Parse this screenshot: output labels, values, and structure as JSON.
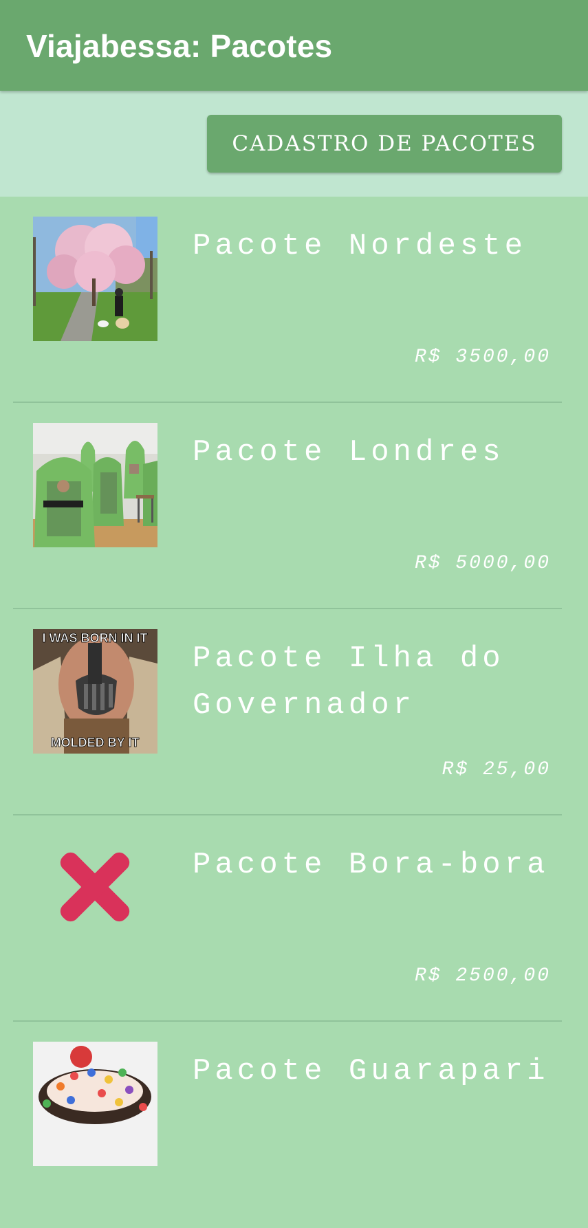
{
  "app": {
    "title": "Viajabessa: Pacotes"
  },
  "toolbar": {
    "button_label": "CADASTRO DE PACOTES"
  },
  "packages": [
    {
      "name": "Pacote Nordeste",
      "price": "R$ 3500,00",
      "image": "cherry-blossom-street-photo"
    },
    {
      "name": "Pacote Londres",
      "price": "R$ 5000,00",
      "image": "green-booths-room-photo"
    },
    {
      "name": "Pacote Ilha do Governador",
      "price": "R$ 25,00",
      "image": "bane-meme",
      "image_text": {
        "top": "I WAS BORN IN IT",
        "bottom": "MOLDED BY IT"
      }
    },
    {
      "name": "Pacote Bora-bora",
      "price": "R$ 2500,00",
      "image": "close-x-icon"
    },
    {
      "name": "Pacote Guarapari",
      "price": "",
      "image": "dessert-bowl-photo"
    }
  ],
  "colors": {
    "appbar": "#6aa86e",
    "toolbar_bg": "#c0e6d0",
    "list_bg": "#a8dbaf",
    "divider": "#90c39a",
    "x_icon": "#d9325a"
  }
}
